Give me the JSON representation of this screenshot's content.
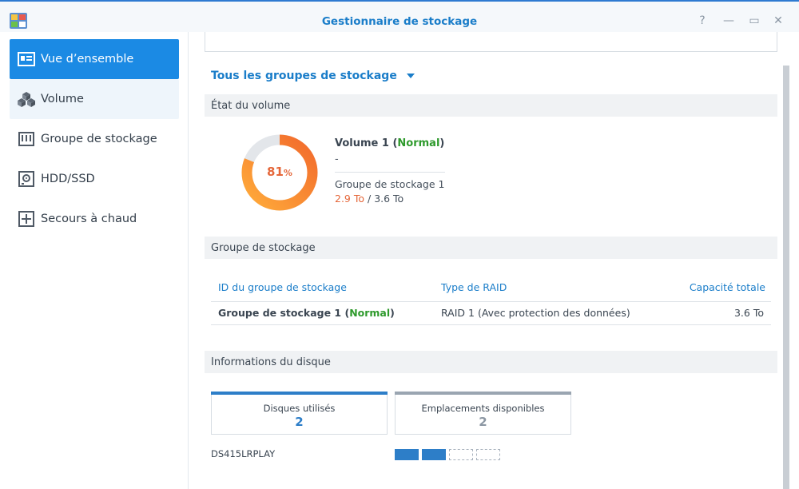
{
  "window": {
    "title": "Gestionnaire de stockage",
    "controls": {
      "help": "?",
      "minimize": "—",
      "maximize": "▭",
      "close": "✕"
    }
  },
  "sidebar": {
    "items": [
      {
        "label": "Vue d’ensemble",
        "icon": "overview-icon",
        "active": true
      },
      {
        "label": "Volume",
        "icon": "volume-icon",
        "active": false
      },
      {
        "label": "Groupe de stockage",
        "icon": "storage-pool-icon",
        "active": false
      },
      {
        "label": "HDD/SSD",
        "icon": "hdd-icon",
        "active": false
      },
      {
        "label": "Secours à chaud",
        "icon": "hot-spare-icon",
        "active": false
      }
    ]
  },
  "main": {
    "group_selector": "Tous les groupes de stockage",
    "volume_section": {
      "title": "État du volume",
      "usage_percent": 81,
      "usage_label": "81",
      "usage_unit": "%",
      "volume_name": "Volume 1",
      "status": "Normal",
      "description": "-",
      "pool_name": "Groupe de stockage 1",
      "used": "2.9 To",
      "total": "3.6 To",
      "ring_colors": {
        "used": "#ff8a2a",
        "free": "#e3e6ea"
      }
    },
    "pool_section": {
      "title": "Groupe de stockage",
      "columns": [
        "ID du groupe de stockage",
        "Type de RAID",
        "Capacité totale"
      ],
      "rows": [
        {
          "id": "Groupe de stockage 1",
          "status": "Normal",
          "raid": "RAID 1 (Avec protection des données)",
          "capacity": "3.6 To"
        }
      ]
    },
    "disk_section": {
      "title": "Informations du disque",
      "cards": [
        {
          "label": "Disques utilisés",
          "value": "2",
          "color": "#2d7ec8"
        },
        {
          "label": "Emplacements disponibles",
          "value": "2",
          "color": "#9aa5b1"
        }
      ],
      "model": "DS415LRPLAY",
      "bays": [
        "used",
        "used",
        "empty",
        "empty"
      ]
    }
  }
}
